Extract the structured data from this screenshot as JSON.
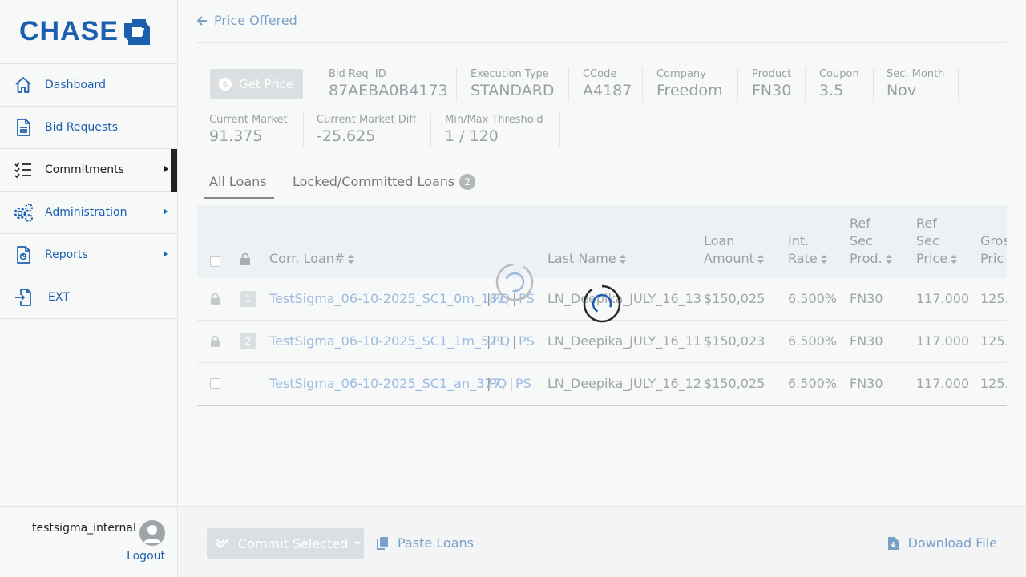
{
  "brand": {
    "logo_text": "CHASE",
    "color": "#1b5fae"
  },
  "sidebar": {
    "items": [
      {
        "label": "Dashboard",
        "icon": "home-icon"
      },
      {
        "label": "Bid Requests",
        "icon": "document-icon"
      },
      {
        "label": "Commitments",
        "icon": "checklist-icon",
        "active": true
      },
      {
        "label": "Administration",
        "icon": "gears-icon"
      },
      {
        "label": "Reports",
        "icon": "report-icon"
      },
      {
        "label": "EXT",
        "icon": "export-icon"
      }
    ],
    "username": "testsigma_internal",
    "logout": "Logout"
  },
  "header": {
    "back_label": "Price Offered"
  },
  "actions": {
    "get_price": "Get Price"
  },
  "details": {
    "bid_req_id": {
      "label": "Bid Req. ID",
      "value": "87AEBA0B4173"
    },
    "execution_type": {
      "label": "Execution Type",
      "value": "STANDARD"
    },
    "ccode": {
      "label": "CCode",
      "value": "A4187"
    },
    "company": {
      "label": "Company",
      "value": "Freedom"
    },
    "product": {
      "label": "Product",
      "value": "FN30"
    },
    "coupon": {
      "label": "Coupon",
      "value": "3.5"
    },
    "sec_month": {
      "label": "Sec. Month",
      "value": "Nov"
    },
    "current_market": {
      "label": "Current Market",
      "value": "91.375"
    },
    "current_market_diff": {
      "label": "Current Market Diff",
      "value": "-25.625"
    },
    "min_max_threshold": {
      "label": "Min/Max Threshold",
      "value": "1 / 120"
    }
  },
  "tabs": [
    {
      "label": "All Loans",
      "active": true
    },
    {
      "label": "Locked/Committed Loans",
      "badge": "2"
    }
  ],
  "table": {
    "headers": {
      "corr_loan": "Corr. Loan#",
      "last_name": "Last Name",
      "loan_amount_1": "Loan",
      "loan_amount_2": "Amount",
      "int_rate_1": "Int.",
      "int_rate_2": "Rate",
      "ref_sec_prod_1": "Ref",
      "ref_sec_prod_2": "Sec",
      "ref_sec_prod_3": "Prod.",
      "ref_sec_price_1": "Ref",
      "ref_sec_price_2": "Sec",
      "ref_sec_price_3": "Price",
      "gross_price_1": "Gros",
      "gross_price_2": "Pric"
    },
    "rows": [
      {
        "num": "1",
        "locked": true,
        "corr_loan": "TestSigma_06-10-2025_SC1_0m_182",
        "pq": "PQ",
        "ps": "PS",
        "sep": "|",
        "last_name": "LN_Deepika_JULY_16_13",
        "loan_amount": "$150,025",
        "int_rate": "6.500%",
        "ref_sec_prod": "FN30",
        "ref_sec_price": "117.000",
        "gross_price": "125."
      },
      {
        "num": "2",
        "locked": true,
        "corr_loan": "TestSigma_06-10-2025_SC1_1m_521",
        "pq": "PQ",
        "ps": "PS",
        "sep": "|",
        "last_name": "LN_Deepika_JULY_16_11",
        "loan_amount": "$150,023",
        "int_rate": "6.500%",
        "ref_sec_prod": "FN30",
        "ref_sec_price": "117.000",
        "gross_price": "125."
      },
      {
        "num": "",
        "locked": false,
        "corr_loan": "TestSigma_06-10-2025_SC1_an_377",
        "pq": "PQ",
        "ps": "PS",
        "sep": "|",
        "last_name": "LN_Deepika_JULY_16_12",
        "loan_amount": "$150,025",
        "int_rate": "6.500%",
        "ref_sec_prod": "FN30",
        "ref_sec_price": "117.000",
        "gross_price": "125."
      }
    ]
  },
  "footer": {
    "commit_selected": "Commit Selected",
    "paste_loans": "Paste Loans",
    "download_file": "Download File"
  },
  "colors": {
    "link": "#7a9fc9",
    "disabled_bg": "#dcdfe1",
    "muted_text": "#9aa0a4"
  }
}
